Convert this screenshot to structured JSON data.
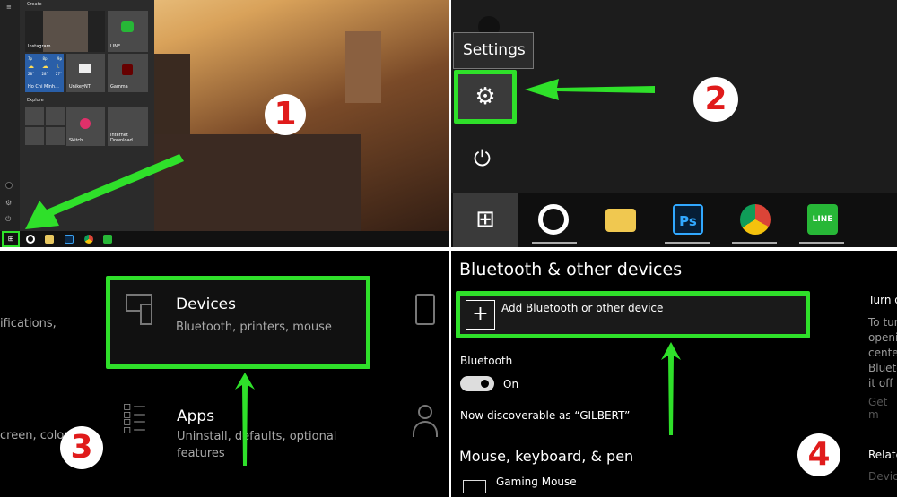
{
  "steps": [
    "1",
    "2",
    "3",
    "4"
  ],
  "accent": "#2fe02a",
  "panel1": {
    "sections": {
      "create": "Create",
      "explore": "Explore"
    },
    "tiles": {
      "instagram": "Instagram",
      "line": "LINE",
      "weather": "Ho Chi Minh...",
      "unikey": "UnikeyNT",
      "gamma": "Gamma",
      "skitch": "Skitch",
      "idm": "Internet Download..."
    },
    "weather": {
      "times": [
        "7p",
        "8p",
        "9p"
      ],
      "temps": [
        "28°",
        "28°",
        "27°"
      ]
    }
  },
  "panel2": {
    "tooltip": "Settings",
    "icons": [
      "windows-start",
      "groove-music",
      "file-explorer",
      "photoshop",
      "chrome",
      "line"
    ],
    "ps_label": "Ps",
    "line_label": "LINE"
  },
  "panel3": {
    "devices": {
      "title": "Devices",
      "subtitle": "Bluetooth, printers, mouse"
    },
    "apps": {
      "title": "Apps",
      "subtitle": "Uninstall, defaults, optional features"
    },
    "partial_left_1": "ifications,",
    "partial_left_2": "creen, color"
  },
  "panel4": {
    "title": "Bluetooth & other devices",
    "add_label": "Add Bluetooth or other device",
    "bluetooth_label": "Bluetooth",
    "toggle_state": "On",
    "discoverable": "Now discoverable as “GILBERT”",
    "mouse_section": "Mouse, keyboard, & pen",
    "gaming_mouse": "Gaming Mouse",
    "right": {
      "heading": "Turn o",
      "lines": [
        "To tur",
        "openi",
        "cente",
        "Blueto",
        "it off v"
      ],
      "link": "Get m",
      "related": "Relate",
      "related_link": "Devic"
    }
  }
}
